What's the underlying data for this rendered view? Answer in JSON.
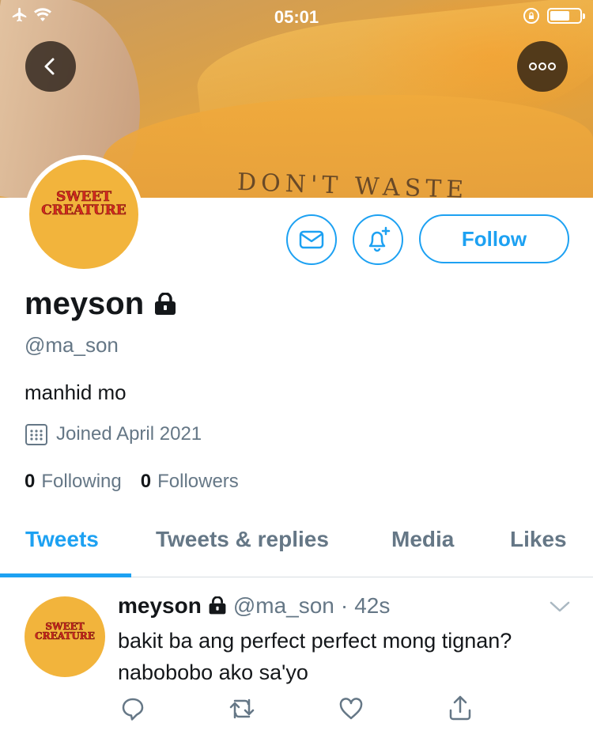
{
  "status_bar": {
    "time": "05:01"
  },
  "banner": {
    "shirt_text": "DON'T WASTE"
  },
  "profile": {
    "avatar_text_line1": "SWEET",
    "avatar_text_line2": "CREATURE",
    "display_name": "meyson",
    "handle": "@ma_son",
    "bio": "manhid mo",
    "joined": "Joined April 2021",
    "following_count": "0",
    "following_label": "Following",
    "followers_count": "0",
    "followers_label": "Followers",
    "follow_label": "Follow"
  },
  "tabs": [
    {
      "label": "Tweets",
      "active": true
    },
    {
      "label": "Tweets & replies",
      "active": false
    },
    {
      "label": "Media",
      "active": false
    },
    {
      "label": "Likes",
      "active": false
    }
  ],
  "tweet": {
    "name": "meyson",
    "handle": "@ma_son",
    "separator": "·",
    "time": "42s",
    "text": "bakit ba ang perfect perfect mong tignan? nabobobo ako sa'yo"
  },
  "colors": {
    "accent": "#1da1f2",
    "secondary_text": "#657786",
    "avatar_bg": "#f2b43c"
  },
  "icons": [
    "airplane-icon",
    "wifi-icon",
    "rotation-lock-icon",
    "battery-icon",
    "back-arrow-icon",
    "more-icon",
    "mail-icon",
    "bell-plus-icon",
    "lock-icon",
    "calendar-icon",
    "chevron-down-icon",
    "reply-icon",
    "retweet-icon",
    "like-icon",
    "share-icon"
  ]
}
